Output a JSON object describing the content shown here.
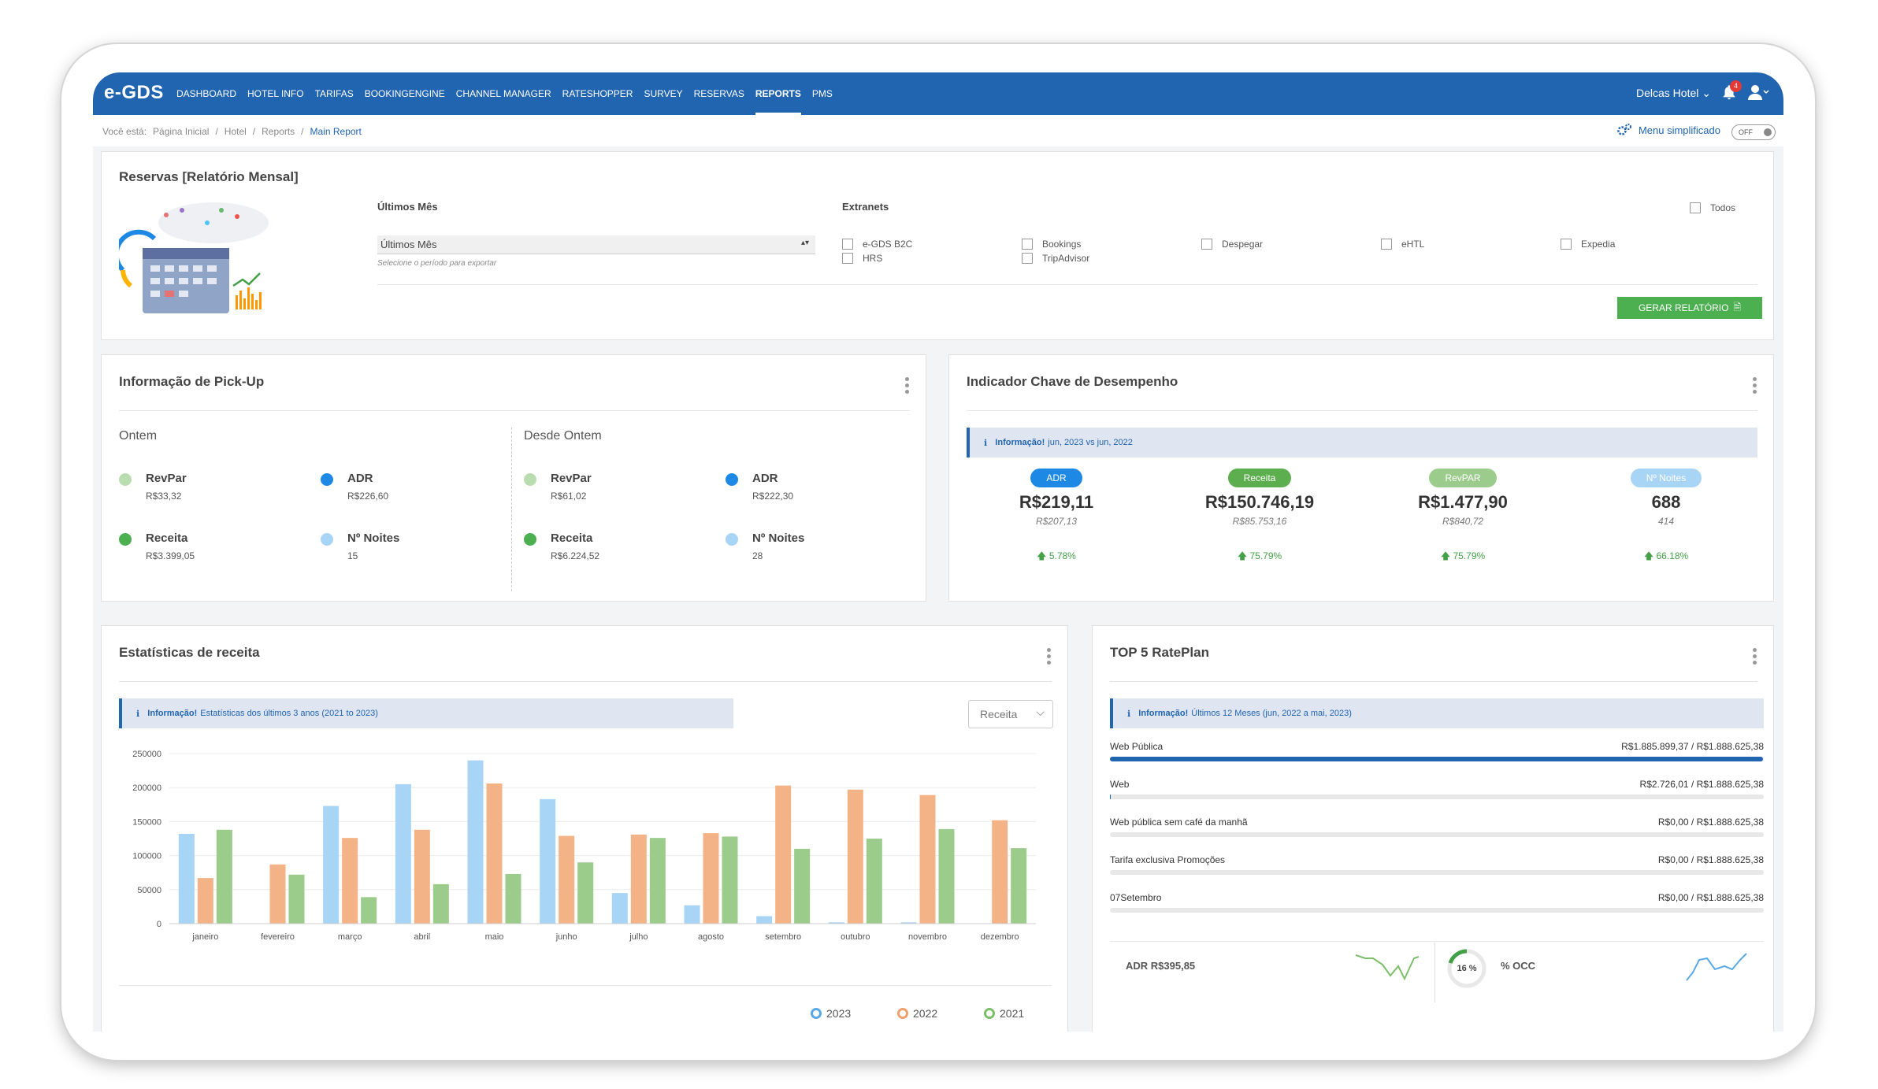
{
  "app": {
    "logo": "e-GDS",
    "hotel": "Delcas Hotel",
    "notifications": "4"
  },
  "nav": [
    {
      "label": "DASHBOARD"
    },
    {
      "label": "HOTEL INFO"
    },
    {
      "label": "TARIFAS"
    },
    {
      "label": "BOOKINGENGINE"
    },
    {
      "label": "CHANNEL MANAGER"
    },
    {
      "label": "RATESHOPPER"
    },
    {
      "label": "SURVEY"
    },
    {
      "label": "RESERVAS"
    },
    {
      "label": "REPORTS",
      "active": true
    },
    {
      "label": "PMS"
    }
  ],
  "breadcrumb": {
    "prefix": "Você está:",
    "items": [
      "Página Inicial",
      "Hotel",
      "Reports"
    ],
    "current": "Main Report"
  },
  "menu_simplificado": {
    "label": "Menu simplificado",
    "toggle": "OFF"
  },
  "reservas": {
    "title": "Reservas [Relatório Mensal]",
    "period_label": "Últimos Mês",
    "period_value": "Últimos Mês",
    "period_hint": "Selecione o período para exportar",
    "extranets_label": "Extranets",
    "todos": "Todos",
    "extranets": [
      "e-GDS B2C",
      "HRS",
      "Bookings",
      "TripAdvisor",
      "Despegar",
      "eHTL",
      "Expedia"
    ],
    "button": "GERAR RELATÓRIO"
  },
  "pickup": {
    "title": "Informação de Pick-Up",
    "ontem": {
      "label": "Ontem",
      "revpar_label": "RevPar",
      "revpar": "R$33,32",
      "adr_label": "ADR",
      "adr": "R$226,60",
      "receita_label": "Receita",
      "receita": "R$3.399,05",
      "noites_label": "Nº Noites",
      "noites": "15"
    },
    "desde": {
      "label": "Desde Ontem",
      "revpar_label": "RevPar",
      "revpar": "R$61,02",
      "adr_label": "ADR",
      "adr": "R$222,30",
      "receita_label": "Receita",
      "receita": "R$6.224,52",
      "noites_label": "Nº Noites",
      "noites": "28"
    }
  },
  "kpi": {
    "title": "Indicador Chave de Desempenho",
    "info_bold": "Informação!",
    "info_text": "jun, 2023 vs jun, 2022",
    "items": [
      {
        "label": "ADR",
        "value": "R$219,11",
        "prev": "R$207,13",
        "change": "5.78%",
        "color": "#1e88e5"
      },
      {
        "label": "Receita",
        "value": "R$150.746,19",
        "prev": "R$85.753,16",
        "change": "75.79%",
        "color": "#5cae4e"
      },
      {
        "label": "RevPAR",
        "value": "R$1.477,90",
        "prev": "R$840,72",
        "change": "75.79%",
        "color": "#9ccc8c"
      },
      {
        "label": "Nº Noites",
        "value": "688",
        "prev": "414",
        "change": "66.18%",
        "color": "#a8d4f5"
      }
    ]
  },
  "receita": {
    "title": "Estatísticas de receita",
    "info_bold": "Informação!",
    "info_text": "Estatísticas dos últimos 3 anos (2021 to 2023)",
    "select": "Receita"
  },
  "chart_data": {
    "type": "bar",
    "categories": [
      "janeiro",
      "fevereiro",
      "março",
      "abril",
      "maio",
      "junho",
      "julho",
      "agosto",
      "setembro",
      "outubro",
      "novembro",
      "dezembro"
    ],
    "ylim": [
      0,
      250000
    ],
    "yticks": [
      "250000",
      "200000",
      "150000",
      "100000",
      "50000",
      "0"
    ],
    "series": [
      {
        "name": "2023",
        "color": "#a8d4f5",
        "values": [
          132000,
          0,
          173000,
          205000,
          240000,
          183000,
          45000,
          27000,
          11000,
          2000,
          2000,
          0
        ]
      },
      {
        "name": "2022",
        "color": "#f4b386",
        "values": [
          67000,
          87000,
          126000,
          138000,
          206000,
          129000,
          131000,
          133000,
          203000,
          197000,
          189000,
          152000
        ]
      },
      {
        "name": "2021",
        "color": "#9ccc8c",
        "values": [
          138000,
          72000,
          39000,
          58000,
          73000,
          90000,
          126000,
          128000,
          110000,
          125000,
          139000,
          111000
        ]
      }
    ]
  },
  "top5": {
    "title": "TOP 5 RatePlan",
    "info_bold": "Informação!",
    "info_text": "Últimos 12 Meses (jun, 2022 a mai, 2023)",
    "items": [
      {
        "name": "Web Pública",
        "value": "R$1.885.899,37 / R$1.888.625,38",
        "fraction": 0.9986
      },
      {
        "name": "Web",
        "value": "R$2.726,01 / R$1.888.625,38",
        "fraction": 0.0014
      },
      {
        "name": "Web pública sem café da manhã",
        "value": "R$0,00 / R$1.888.625,38",
        "fraction": 0
      },
      {
        "name": "Tarifa exclusiva Promoções",
        "value": "R$0,00 / R$1.888.625,38",
        "fraction": 0
      },
      {
        "name": "07Setembro",
        "value": "R$0,00 / R$1.888.625,38",
        "fraction": 0
      }
    ],
    "adr": "ADR R$395,85",
    "occ_pct": "16 %",
    "occ_label": "% OCC"
  }
}
